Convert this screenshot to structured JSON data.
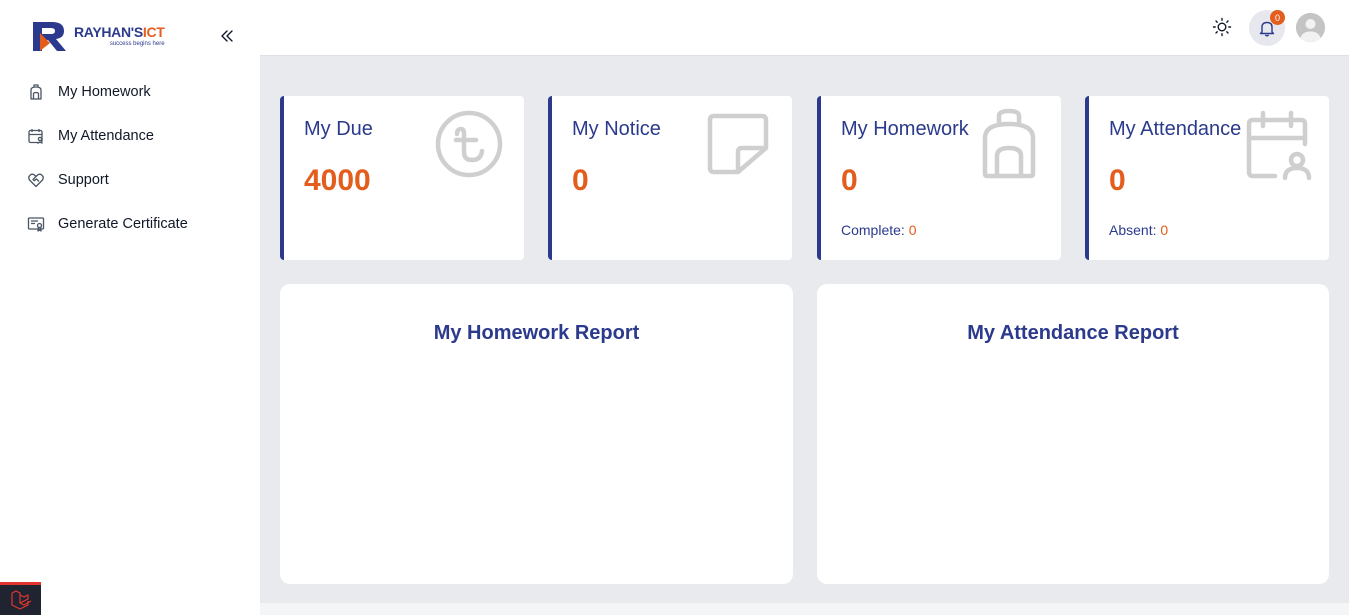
{
  "brand": {
    "name_main": "RAYHAN'S",
    "name_accent": "ICT",
    "tagline": "success begins here",
    "colors": {
      "primary": "#2b3a8c",
      "accent": "#e35d1c"
    }
  },
  "sidebar": {
    "collapse_icon": "double-chevron-left-icon",
    "items": [
      {
        "label": "My Homework",
        "icon": "backpack-icon"
      },
      {
        "label": "My Attendance",
        "icon": "calendar-user-icon"
      },
      {
        "label": "Support",
        "icon": "heart-handshake-icon"
      },
      {
        "label": "Generate Certificate",
        "icon": "certificate-icon"
      }
    ]
  },
  "header": {
    "theme_icon": "sun-icon",
    "notifications": {
      "icon": "bell-icon",
      "count": "0"
    },
    "avatar_icon": "user-avatar-icon"
  },
  "cards": [
    {
      "title": "My Due",
      "value": "4000",
      "icon": "taka-icon"
    },
    {
      "title": "My Notice",
      "value": "0",
      "icon": "sticky-note-icon"
    },
    {
      "title": "My Homework",
      "value": "0",
      "sub_label": "Complete:",
      "sub_value": "0",
      "icon": "backpack-icon"
    },
    {
      "title": "My Attendance",
      "value": "0",
      "sub_label": "Absent:",
      "sub_value": "0",
      "icon": "calendar-user-icon"
    }
  ],
  "reports": [
    {
      "title": "My Homework Report"
    },
    {
      "title": "My Attendance Report"
    }
  ]
}
